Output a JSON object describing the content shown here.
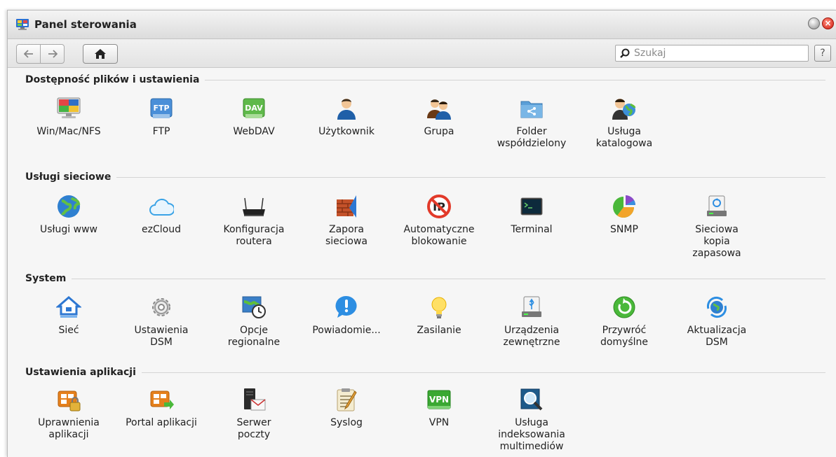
{
  "window": {
    "title": "Panel sterowania",
    "search_placeholder": "Szukaj",
    "help_label": "?"
  },
  "sections": [
    {
      "title": "Dostępność plików i ustawienia",
      "items": [
        "Win/Mac/NFS",
        "FTP",
        "WebDAV",
        "Użytkownik",
        "Grupa",
        "Folder\nwspółdzielony",
        "Usługa\nkatalogowa"
      ]
    },
    {
      "title": "Usługi sieciowe",
      "items": [
        "Usługi www",
        "ezCloud",
        "Konfiguracja\nroutera",
        "Zapora\nsieciowa",
        "Automatyczne\nblokowanie",
        "Terminal",
        "SNMP",
        "Sieciowa\nkopia\nzapasowa"
      ]
    },
    {
      "title": "System",
      "items": [
        "Sieć",
        "Ustawienia\nDSM",
        "Opcje\nregionalne",
        "Powiadomie...",
        "Zasilanie",
        "Urządzenia\nzewnętrzne",
        "Przywróć\ndomyślne",
        "Aktualizacja\nDSM"
      ]
    },
    {
      "title": "Ustawienia aplikacji",
      "items": [
        "Uprawnienia\naplikacji",
        "Portal aplikacji",
        "Serwer\npoczty",
        "Syslog",
        "VPN",
        "Usługa\nindeksowania\nmultimediów"
      ]
    }
  ],
  "icon_text": {
    "ftp": "FTP",
    "dav": "DAV",
    "vpn": "VPN"
  }
}
